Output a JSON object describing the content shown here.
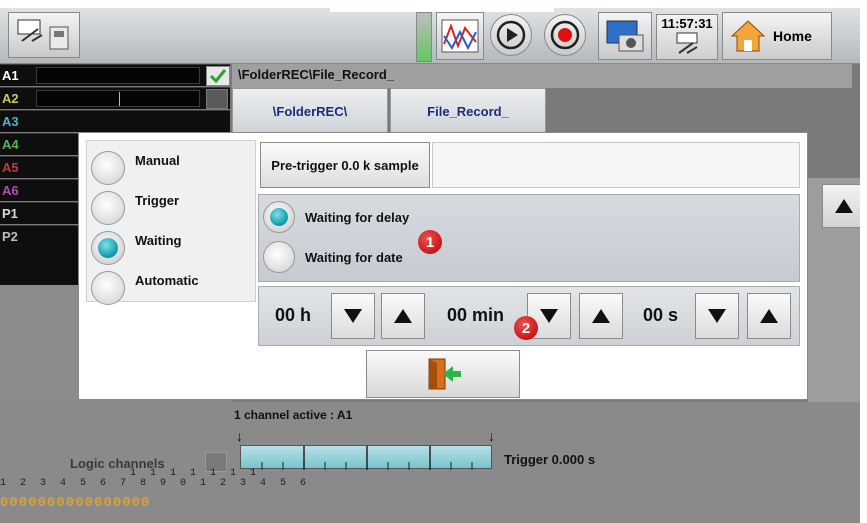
{
  "topbar": {
    "clock": "11:57:31",
    "home_label": "Home"
  },
  "channels": [
    {
      "label": "A1",
      "color": "#ffffff"
    },
    {
      "label": "A2",
      "color": "#c8c85a"
    },
    {
      "label": "A3",
      "color": "#4fb0c9"
    },
    {
      "label": "A4",
      "color": "#4fb84f"
    },
    {
      "label": "A5",
      "color": "#c33a3a"
    },
    {
      "label": "A6",
      "color": "#b34fb3"
    },
    {
      "label": "P1",
      "color": "#d8d8d8"
    },
    {
      "label": "P2",
      "color": "#bdbdbd"
    }
  ],
  "path": "\\FolderREC\\File_Record_",
  "tabs": [
    "\\FolderREC\\",
    "File_Record_"
  ],
  "dialog": {
    "modes": [
      "Manual",
      "Trigger",
      "Waiting",
      "Automatic"
    ],
    "selected_mode": "Waiting",
    "pretrigger_label": "Pre-trigger 0.0 k sample",
    "wait_options": [
      "Waiting for delay",
      "Waiting for date"
    ],
    "selected_wait": "Waiting for delay",
    "hours": "00 h",
    "minutes": "00 min",
    "seconds": "00 s",
    "badge1": "1",
    "badge2": "2"
  },
  "bottom": {
    "channel_active": "1 channel active : A1",
    "trigger": "Trigger 0.000 s",
    "logic_channels_label": "Logic channels",
    "logic_tens": "1 1 1 1 1 1 1",
    "logic_indices": "1 2 3 4 5 6 7 8 9 0 1 2 3 4 5 6",
    "logic_values": "0000000000000000"
  },
  "colors": {
    "radio_on": "#19a3b3",
    "badge": "#c81818",
    "tab_text": "#1a2c7a",
    "check": "#2aa52a"
  }
}
